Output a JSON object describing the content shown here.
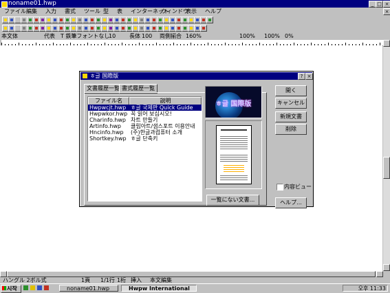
{
  "window": {
    "title": "noname01.hwp",
    "min": "_",
    "max": "□",
    "close": "×"
  },
  "menu": [
    "ファイル",
    "編集",
    "入力",
    "書式",
    "ツール",
    "型",
    "表",
    "インターネット",
    "ウィンドウ",
    "表示",
    "ヘルプ"
  ],
  "format_bar": {
    "style": "本文体",
    "font_type": "代表",
    "font_name": "T 鉄筆フォントなし",
    "size": "10",
    "scale_label": "長体",
    "scale": "100",
    "spacing_label": "両側揃合",
    "zoom": "160%",
    "zoom2": "100%",
    "zoom3": "100%",
    "pct": "0%"
  },
  "dialog": {
    "title": "ㅎ글 国際版",
    "help_btn": "?",
    "close_btn": "×",
    "tabs": [
      "文書履歴一覧",
      "書式履歴一覧"
    ],
    "columns": [
      "ファイル名",
      "説明"
    ],
    "rows": [
      [
        "Hwpwcjt.hwp",
        "ㅎ글 국제판 Quick Guide"
      ],
      [
        "Hwpwkor.hwp",
        "꼭 읽어 보십시오!"
      ],
      [
        "Charinfo.hwp",
        "차트 만들기"
      ],
      [
        "Artinfo.hwp",
        "클립아트/샘스포트 이용안내"
      ],
      [
        "Hncinfo.hwp",
        "(주)한글과컴퓨터 소개"
      ],
      [
        "Shortkey.hwp",
        "ㅎ글 단축키"
      ]
    ],
    "banner_text": "ㅎ글 国際版",
    "buttons": {
      "open": "開く",
      "cancel": "キャンセル",
      "new": "新規文書",
      "delete": "削除",
      "list_other": "一覧にない文書...",
      "help": "ヘルプ..."
    },
    "preview_checkbox": "内容ビュー"
  },
  "status": {
    "mode": "ハングル 2ボル式",
    "page": "1頁",
    "line": "1/1行",
    "col": "1桁",
    "insert": "挿入",
    "edit": "本文編集"
  },
  "taskbar": {
    "start": "시작",
    "tasks": [
      "noname01.hwp",
      "Hwpw International"
    ],
    "clock": "오후 11:33"
  }
}
